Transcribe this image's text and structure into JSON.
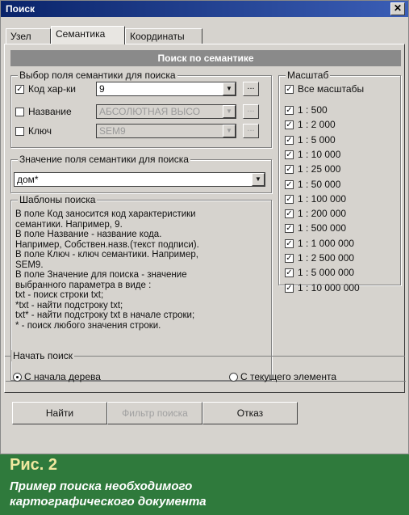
{
  "window": {
    "title": "Поиск",
    "close_glyph": "✕"
  },
  "tabs": [
    "Узел",
    "Семантика",
    "Координаты"
  ],
  "banner": "Поиск по семантике",
  "semantic_field": {
    "legend": "Выбор поля семантики для поиска",
    "rows": [
      {
        "label": "Код хар-ки",
        "checked": true,
        "value": "9",
        "enabled": true
      },
      {
        "label": "Название",
        "checked": false,
        "value": "АБСОЛЮТНАЯ ВЫСО",
        "enabled": false
      },
      {
        "label": "Ключ",
        "checked": false,
        "value": "SEM9",
        "enabled": false
      }
    ],
    "browse_label": "..."
  },
  "search_value": {
    "legend": "Значение поля семантики для поиска",
    "value": "дом*"
  },
  "templates": {
    "legend": "Шаблоны поиска",
    "lines": [
      "В поле Код заносится код характеристики",
      "семантики. Например, 9.",
      "В поле Название - название кода.",
      "Например, Собствен.назв.(текст подписи).",
      "В поле Ключ - ключ семантики. Например,",
      "SEM9.",
      "В поле Значение для поиска - значение",
      "выбранного параметра в виде :",
      "txt - поиск строки txt;",
      "*txt - найти подстроку txt;",
      "txt* - найти подстроку txt в начале строки;",
      "*    - поиск любого значения строки."
    ]
  },
  "scale": {
    "legend": "Масштаб",
    "all_label": "Все масштабы",
    "all_checked": true,
    "items": [
      "1 : 500",
      "1 : 2 000",
      "1 : 5 000",
      "1 : 10 000",
      "1 : 25 000",
      "1 : 50 000",
      "1 : 100 000",
      "1 : 200 000",
      "1 : 500 000",
      "1 : 1 000 000",
      "1 : 2 500 000",
      "1 : 5 000 000",
      "1 : 10 000 000"
    ]
  },
  "start": {
    "legend": "Начать поиск",
    "options": [
      {
        "label": "С начала дерева",
        "selected": true
      },
      {
        "label": "С текущего элемента",
        "selected": false
      }
    ]
  },
  "buttons": {
    "find": "Найти",
    "filter": "Фильтр поиска",
    "cancel": "Отказ"
  },
  "caption": {
    "heading": "Рис. 2",
    "line1": "Пример поиска необходимого",
    "line2": "картографического документа"
  },
  "check_glyph": "✓"
}
